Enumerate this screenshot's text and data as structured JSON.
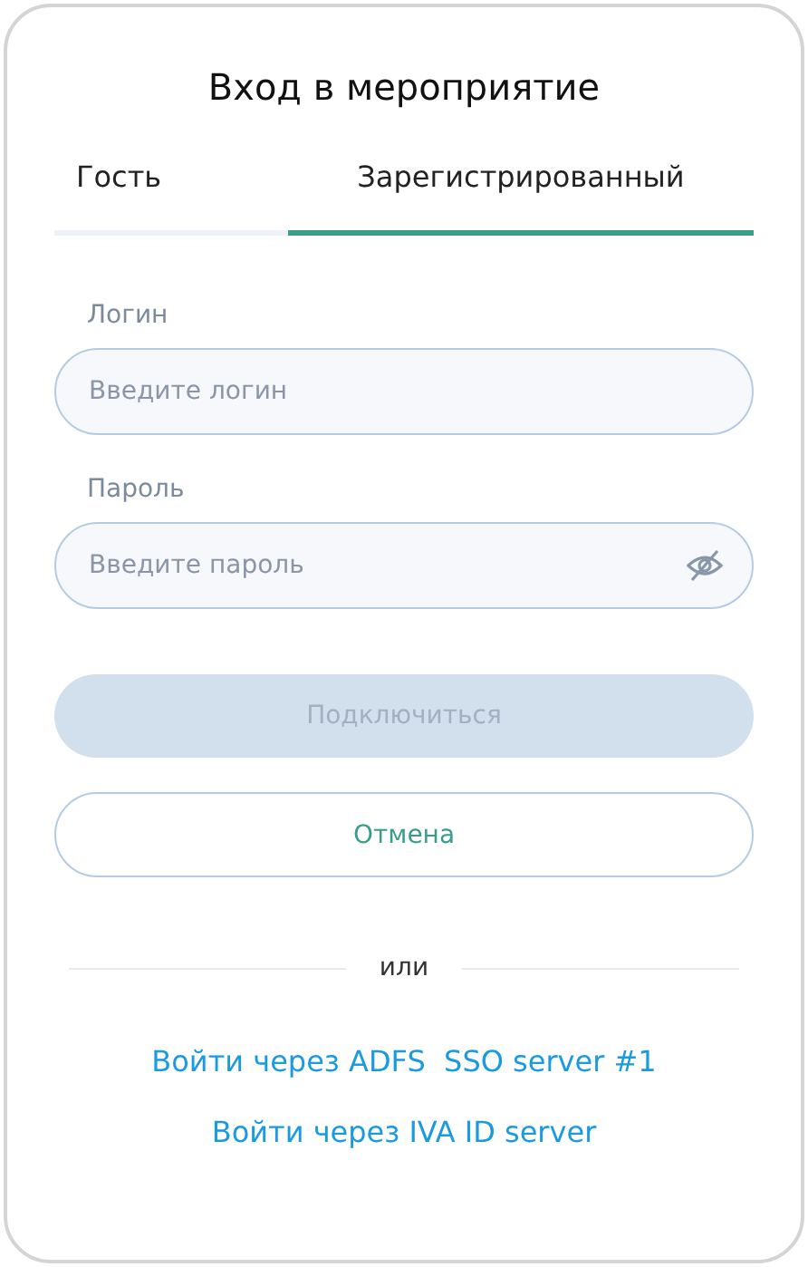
{
  "title": "Вход в мероприятие",
  "tabs": [
    {
      "label": "Гость",
      "selected": false
    },
    {
      "label": "Зарегистрированный",
      "selected": true
    }
  ],
  "fields": [
    {
      "kind": "text",
      "label": "Логин",
      "placeholder": "Введите логин"
    },
    {
      "kind": "password",
      "label": "Пароль",
      "placeholder": "Введите пароль"
    }
  ],
  "submit_button": {
    "label": "Подключиться",
    "disabled": true
  },
  "cancel_button": {
    "label": "Отмена"
  },
  "divider_text": "или",
  "links": [
    "Войти через ADFS  SSO server #1",
    "Войти через IVA ID server"
  ]
}
